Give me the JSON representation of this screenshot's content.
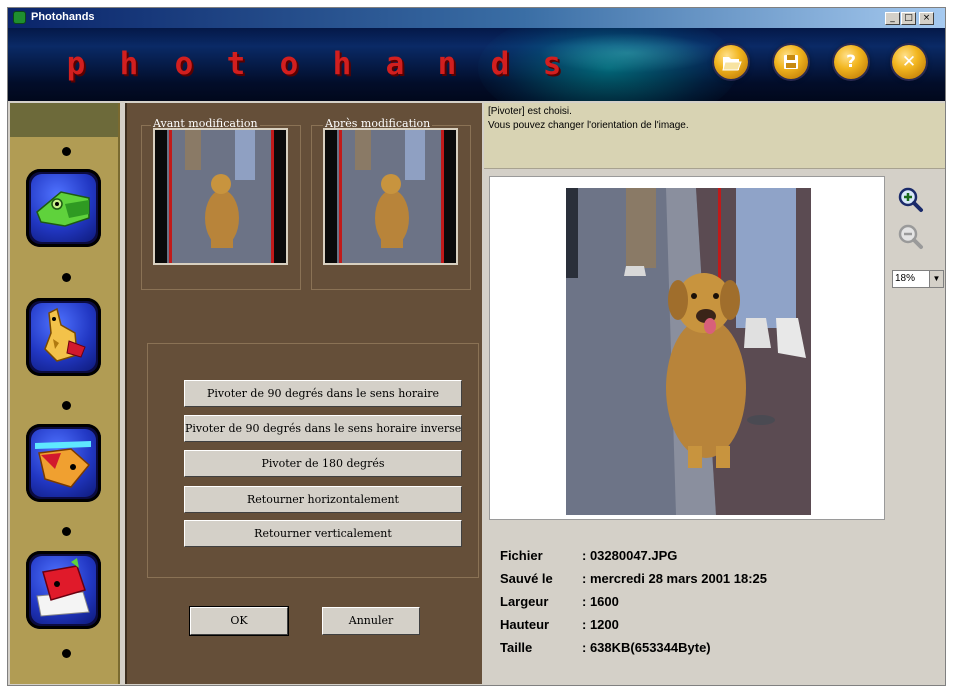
{
  "window": {
    "title": "Photohands",
    "controls": [
      "_",
      "□",
      "×"
    ]
  },
  "banner": {
    "logo_letters": [
      "p",
      "h",
      "o",
      "t",
      "o",
      "h",
      "a",
      "n",
      "d",
      "s"
    ],
    "buttons": [
      {
        "name": "open",
        "icon": "folder-open-icon"
      },
      {
        "name": "save",
        "icon": "floppy-disk-icon"
      },
      {
        "name": "help",
        "icon": "question-icon"
      },
      {
        "name": "exit",
        "icon": "close-icon"
      }
    ]
  },
  "sidebar": {
    "tools": [
      {
        "icon": "chameleon-icon"
      },
      {
        "icon": "giraffe-icon"
      },
      {
        "icon": "fish-icon"
      },
      {
        "icon": "red-creature-icon"
      }
    ]
  },
  "preview": {
    "before_label": "Avant modification",
    "after_label": "Après modification"
  },
  "actions": {
    "items": [
      "Pivoter de 90 degrés dans le sens horaire",
      "Pivoter de 90 degrés dans le sens horaire inverse",
      "Pivoter de 180 degrés",
      "Retourner horizontalement",
      "Retourner verticalement"
    ],
    "ok_label": "OK",
    "cancel_label": "Annuler"
  },
  "message": {
    "line1": "[Pivoter] est choisi.",
    "line2": "Vous pouvez changer l'orientation  de l'image."
  },
  "zoom": {
    "value": "18%",
    "zoom_in_icon": "zoom-in-icon",
    "zoom_out_icon": "zoom-out-icon"
  },
  "file_info": [
    {
      "label": "Fichier",
      "value": ": 03280047.JPG"
    },
    {
      "label": "Sauvé le",
      "value": ": mercredi 28 mars 2001 18:25"
    },
    {
      "label": "Largeur",
      "value": ": 1600"
    },
    {
      "label": "Hauteur",
      "value": ": 1200"
    },
    {
      "label": "Taille",
      "value": ": 638KB(653344Byte)"
    }
  ],
  "colors": {
    "sidebar": "#b19c54",
    "middle_panel": "#654f39",
    "message_bg": "#d8d3b3",
    "logo_letters": "#d21f1f",
    "toolbar_buttons": "#f2b620"
  }
}
